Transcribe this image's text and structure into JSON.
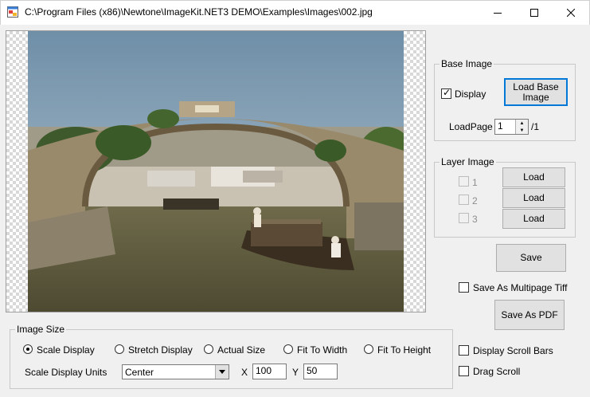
{
  "window": {
    "title": "C:\\Program Files (x86)\\Newtone\\ImageKit.NET3 DEMO\\Examples\\Images\\002.jpg",
    "icon": "app-window-icon",
    "controls": [
      "minimize-icon",
      "maximize-icon",
      "close-icon"
    ]
  },
  "base_image": {
    "legend": "Base Image",
    "display_label": "Display",
    "display_checked": true,
    "load_button": "Load Base\nImage",
    "loadpage_label": "LoadPage",
    "loadpage_value": "1",
    "page_total": "/1"
  },
  "layer_image": {
    "legend": "Layer Image",
    "layers": [
      {
        "label": "1",
        "checked": false,
        "enabled": false,
        "button": "Load"
      },
      {
        "label": "2",
        "checked": false,
        "enabled": false,
        "button": "Load"
      },
      {
        "label": "3",
        "checked": false,
        "enabled": false,
        "button": "Load"
      }
    ]
  },
  "actions": {
    "save": "Save",
    "save_multipage_label": "Save As Multipage Tiff",
    "save_multipage_checked": false,
    "save_pdf": "Save As PDF",
    "display_scroll_bars_label": "Display Scroll Bars",
    "display_scroll_bars_checked": false,
    "drag_scroll_label": "Drag Scroll",
    "drag_scroll_checked": false
  },
  "image_size": {
    "legend": "Image Size",
    "options": [
      "Scale Display",
      "Stretch Display",
      "Actual Size",
      "Fit To Width",
      "Fit To Height"
    ],
    "selected": "Scale Display",
    "units_label": "Scale Display Units",
    "units_value": "Center",
    "x_label": "X",
    "x_value": "100",
    "y_label": "Y",
    "y_value": "50"
  },
  "colors": {
    "default_button_border": "#0078d7",
    "window_bg": "#f0f0f0"
  }
}
